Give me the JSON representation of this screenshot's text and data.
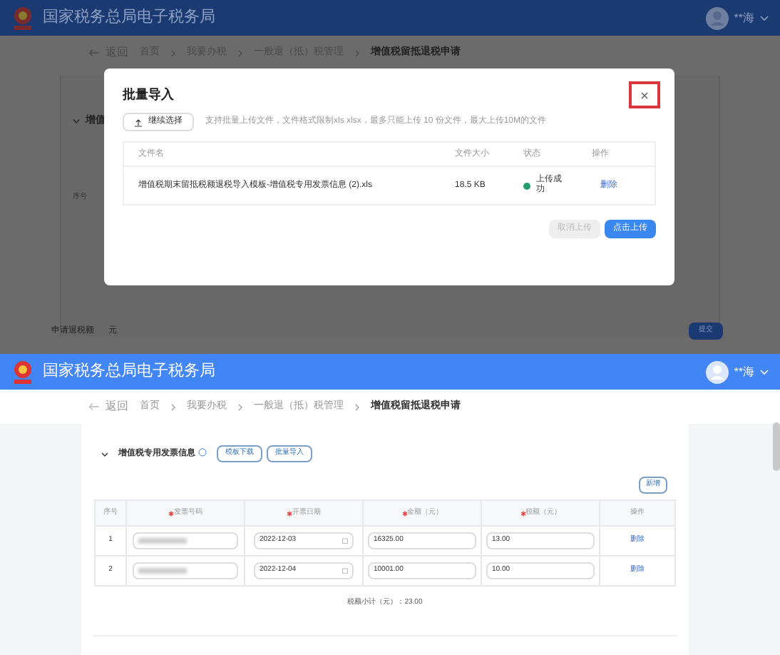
{
  "top_screen": {
    "header": {
      "site_title": "国家税务总局电子税务局",
      "user_name": "**海"
    },
    "breadcrumb": {
      "back": "返回",
      "items": [
        "首页",
        "我要办税",
        "一般退（抵）税管理",
        "增值税留抵退税申请"
      ]
    },
    "background": {
      "section_title": "增值",
      "table_header": "序号",
      "refund_label": "申请退税额",
      "refund_unit": "元",
      "submit": "提交"
    },
    "dialog": {
      "title": "批量导入",
      "select_button": "继续选择",
      "hint": "支持批量上传文件，文件格式限制xls xlsx，最多只能上传 10 份文件，最大上传10M的文件",
      "columns": [
        "文件名",
        "文件大小",
        "状态",
        "操作"
      ],
      "files": [
        {
          "name": "增值税期末留抵税额退税导入模板-增值税专用发票信息 (2).xls",
          "size": "18.5 KB",
          "status": "上传成功",
          "color": "#22a06b",
          "action": "删除"
        }
      ],
      "cancel": "取消上传",
      "upload": "点击上传",
      "cancel_disabled": true
    }
  },
  "bottom_screen": {
    "header": {
      "site_title": "国家税务总局电子税务局",
      "user_name": "**海"
    },
    "breadcrumb": {
      "back": "返回",
      "items": [
        "首页",
        "我要办税",
        "一般退（抵）税管理",
        "增值税留抵退税申请"
      ]
    },
    "section": {
      "title": "增值税专用发票信息",
      "expanded": true,
      "template_button": "模板下载",
      "import_button": "批量导入",
      "add_button": "新增"
    },
    "table": {
      "columns": [
        {
          "label": "序号",
          "required": false
        },
        {
          "label": "发票号码",
          "required": true
        },
        {
          "label": "开票日期",
          "required": true
        },
        {
          "label": "金额（元）",
          "required": true
        },
        {
          "label": "税额（元）",
          "required": true
        },
        {
          "label": "操作",
          "required": false
        }
      ],
      "rows": [
        {
          "index": "1",
          "date": "2022-12-03",
          "amount": "16325.00",
          "tax": "13.00",
          "action": "删除"
        },
        {
          "index": "2",
          "date": "2022-12-04",
          "amount": "10001.00",
          "tax": "10.00",
          "action": "删除"
        }
      ]
    },
    "total": "税额小计（元）：23.00"
  }
}
